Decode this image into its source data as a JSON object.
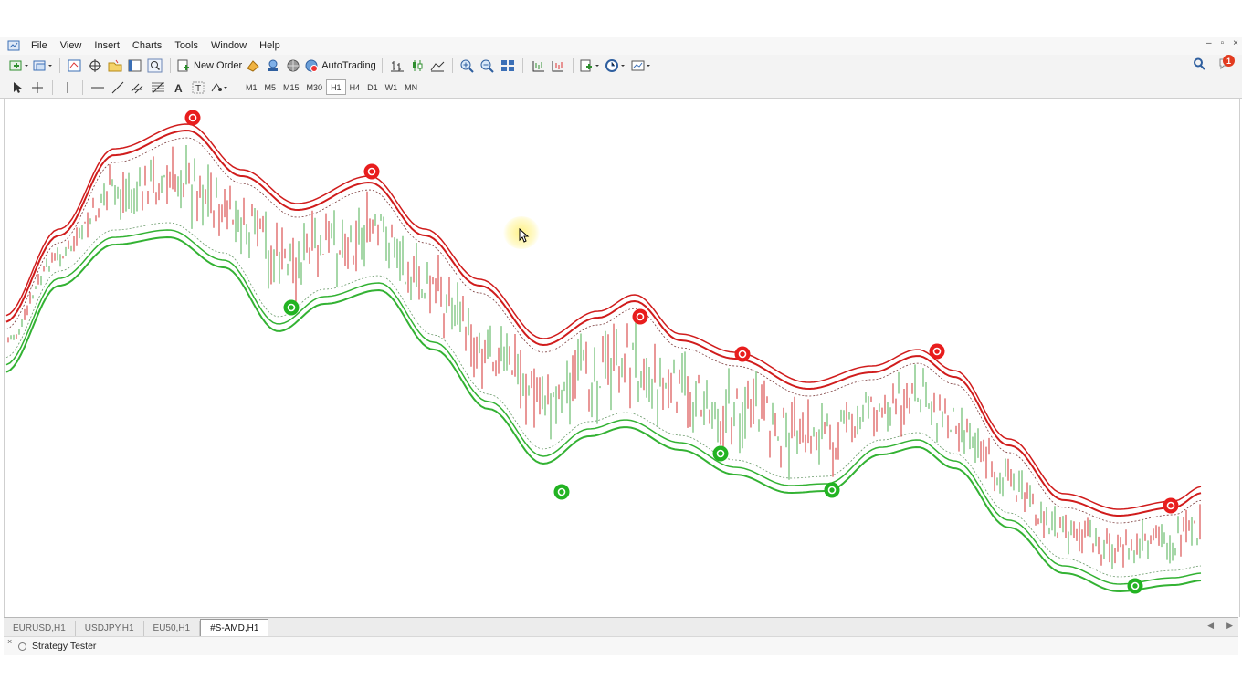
{
  "menu": [
    "File",
    "View",
    "Insert",
    "Charts",
    "Tools",
    "Window",
    "Help"
  ],
  "window_controls": [
    "–",
    "▫",
    "×"
  ],
  "toolbar": {
    "new_order_label": "New Order",
    "autotrading_label": "AutoTrading"
  },
  "timeframes": [
    "M1",
    "M5",
    "M15",
    "M30",
    "H1",
    "H4",
    "D1",
    "W1",
    "MN"
  ],
  "active_timeframe": "H1",
  "notification_count": "1",
  "tabs": [
    "EURUSD,H1",
    "USDJPY,H1",
    "EU50,H1",
    "#S-AMD,H1"
  ],
  "active_tab": "#S-AMD,H1",
  "tester": {
    "close": "×",
    "label": "Strategy Tester"
  },
  "colors": {
    "bull_candle": "#4caf50",
    "bear_candle": "#d32f2f",
    "upper_band": "#d01c1c",
    "lower_band": "#33b233",
    "sell_signal": "#e81d1d",
    "buy_signal": "#22b322"
  }
}
